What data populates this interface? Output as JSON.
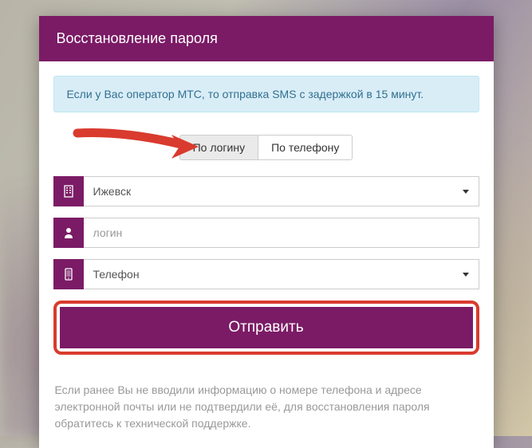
{
  "header": {
    "title": "Восстановление пароля"
  },
  "info": {
    "text": "Если у Вас оператор МТС, то отправка SMS с задержкой в 15 минут."
  },
  "tabs": {
    "by_login": "По логину",
    "by_phone": "По телефону"
  },
  "fields": {
    "city": {
      "value": "Ижевск"
    },
    "login": {
      "placeholder": "логин"
    },
    "phone": {
      "value": "Телефон"
    }
  },
  "submit": {
    "label": "Отправить"
  },
  "footer": {
    "text": "Если ранее Вы не вводили информацию о номере телефона и адресе электронной почты или не подтвердили её, для восстановления пароля обратитесь к технической поддержке."
  }
}
